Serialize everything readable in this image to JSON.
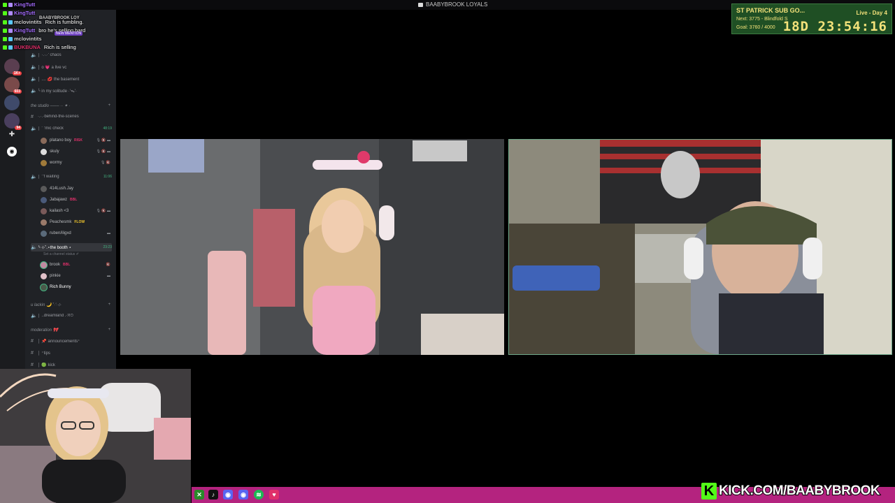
{
  "window": {
    "title": "BAABYBROOK LOYALS"
  },
  "chat": [
    {
      "user": "KingTutt",
      "message": "",
      "color": "#a56cff"
    },
    {
      "user": "KingTutt",
      "message": "",
      "color": "#a56cff"
    },
    {
      "user": "BAABYBROOK LOY",
      "message": "",
      "color": "#d0d0d0"
    },
    {
      "user": "mclovintits",
      "message": "Rich is fumbling.",
      "color": "#d0d0d0"
    },
    {
      "user": "KingTutt",
      "message": "bro he's selling hard",
      "color": "#a56cff"
    },
    {
      "user": "mclovintits",
      "message": "",
      "color": "#d0d0d0"
    },
    {
      "user": "BUKBUNA",
      "message": "Rich is selling",
      "color": "#e0306a"
    }
  ],
  "chat_mention_badge": "NEW MENTION",
  "rail": {
    "badges": [
      "1K+",
      "603",
      "94"
    ],
    "add_icon": "plus-icon",
    "discover_icon": "compass-icon"
  },
  "channels": {
    "top": [
      {
        "icon": "speaker-icon",
        "label": "│ ·.·.·' chaos"
      },
      {
        "icon": "speaker-icon",
        "label": "│ o 💗 a live vc"
      },
      {
        "icon": "speaker-icon",
        "label": "│ .... 💋 the basement"
      },
      {
        "icon": "speaker-icon",
        "label": "╰ in my solitude ·'ᯓ'·"
      }
    ],
    "studio": {
      "category": "the studio ─── ·· ✦ ·",
      "channels": [
        {
          "icon": "hash-icon",
          "label": "·.·.·behind-the-scenes",
          "right": ""
        },
        {
          "icon": "speaker-icon",
          "label": "│ ˚ 'mic check",
          "right": "48:19",
          "members": [
            {
              "name": "platano boy",
              "tag": "RISK",
              "tag_color": "#e0306a",
              "status": "🎙 🔇 ▬"
            },
            {
              "name": "skuly",
              "tag": "",
              "tag_color": "",
              "status": "🎙 🔇 ▬"
            },
            {
              "name": "wormy",
              "tag": "",
              "tag_color": "",
              "status": "🎙 🔇"
            }
          ]
        },
        {
          "icon": "speaker-icon",
          "label": "│ ˚'f waiting",
          "right": "11:06",
          "members": [
            {
              "name": "414Lush.Jay",
              "tag": "",
              "tag_color": "",
              "status": ""
            },
            {
              "name": "Jabajawz",
              "tag": "BBL",
              "tag_color": "#e0306a",
              "status": ""
            },
            {
              "name": "kailash <3",
              "tag": "",
              "tag_color": "",
              "status": "🎙 🔇 ▬"
            },
            {
              "name": "Peachesmk",
              "tag": "FLOW",
              "tag_color": "#f3c72d",
              "status": ""
            },
            {
              "name": "ruben/iligxd",
              "tag": "",
              "tag_color": "",
              "status": "▬"
            }
          ]
        },
        {
          "icon": "speaker-icon",
          "label": "╰ ⊹˚.⋆the booth ⋆",
          "right": "23:23",
          "substatus": "Set a channel status ✐",
          "members": [
            {
              "name": "brook",
              "tag": "BBL",
              "tag_color": "#e0306a",
              "status": "🔇"
            },
            {
              "name": "pinkie",
              "tag": "",
              "tag_color": "",
              "status": "▬"
            },
            {
              "name": "Rich Bunny",
              "tag": "",
              "tag_color": "",
              "status": ""
            }
          ]
        }
      ]
    },
    "lackin": {
      "category": "u lackin 🌙 ˚·'·⊹",
      "channels": [
        {
          "icon": "speaker-icon",
          "label": "│ ..dreamland .·ᘝ⊙"
        }
      ]
    },
    "moderation": {
      "category": "moderation 🎀",
      "channels": [
        {
          "icon": "hash-icon",
          "label": "│ 📌 announcements⁺"
        },
        {
          "icon": "hash-icon",
          "label": "│ ⁺tips"
        },
        {
          "icon": "hash-icon",
          "label": "│ 🟢 kick"
        }
      ]
    }
  },
  "subathon": {
    "title": "ST PATRICK SUB GO...",
    "live_day": "Live - Day 4",
    "next": "Next: 3775 - Blindfold S",
    "goal": "Goal: 3760 / 4000",
    "countdown": "18D 23:54:16"
  },
  "footer": {
    "kick_logo": "K",
    "kick_url": "KICK.COM/BAABYBROOK",
    "socials": [
      "xbox-icon",
      "tiktok-icon",
      "discord-icon",
      "discord-icon",
      "spotify-icon",
      "heart-icon"
    ]
  },
  "colors": {
    "discord_bg": "#202226",
    "rail_bg": "#1b1c1f",
    "bottom_bar": "#b4237f",
    "kick_green": "#53fc18",
    "timer_bg": "#1f4f24",
    "timer_text": "#f3e27a"
  }
}
